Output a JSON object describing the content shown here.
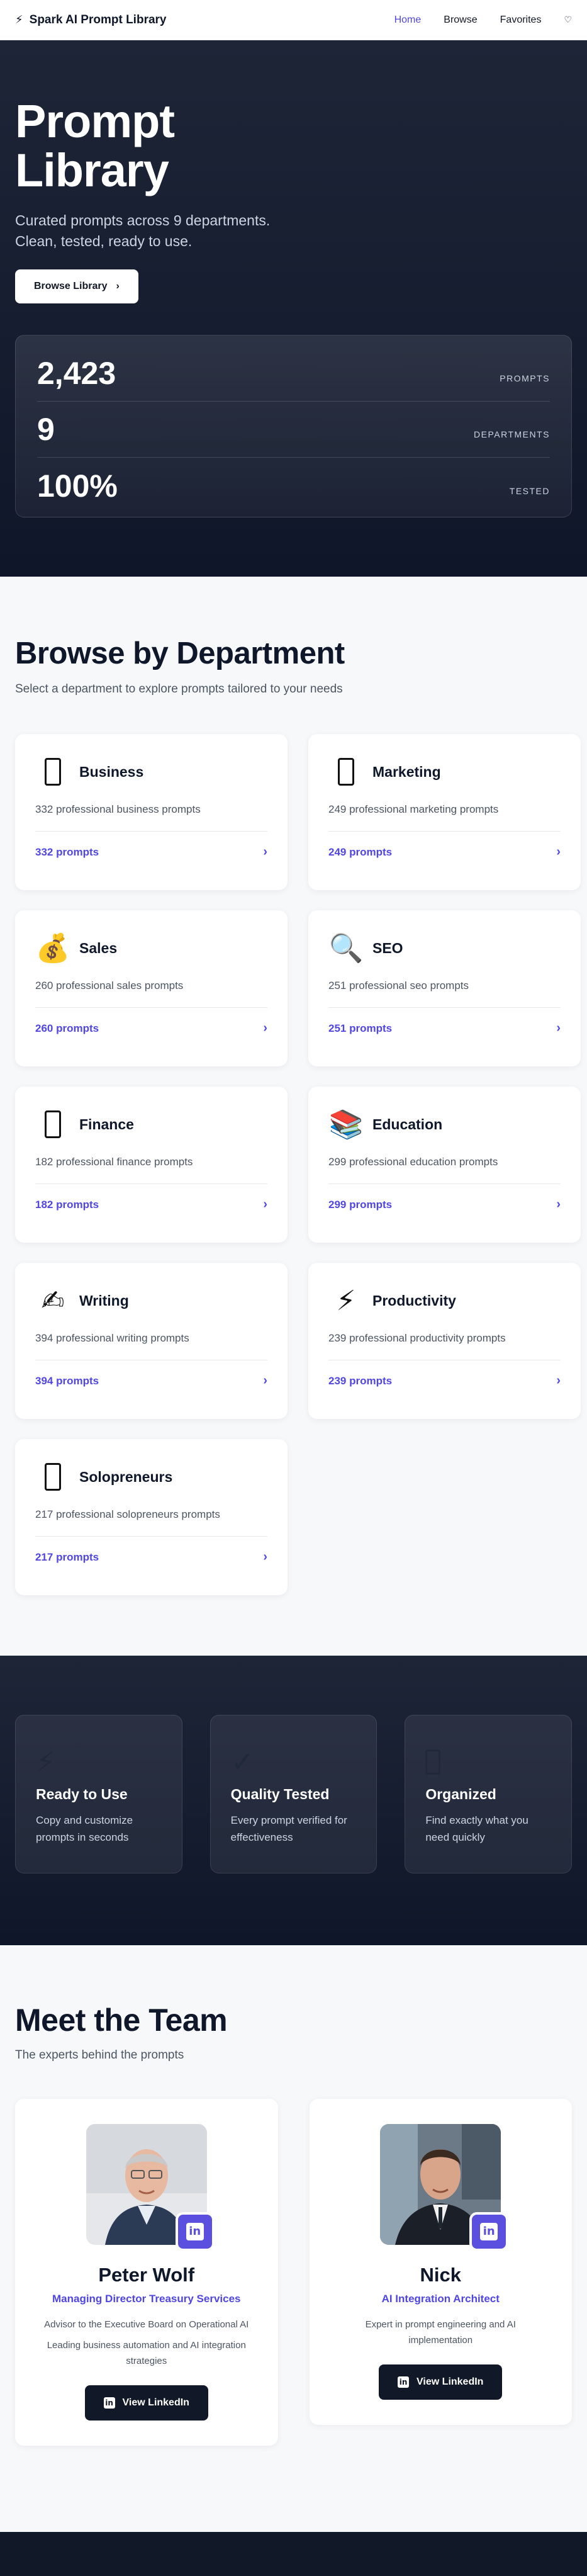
{
  "nav": {
    "brand": "Spark AI Prompt Library",
    "brand_icon": "⚡",
    "links": [
      "Home",
      "Browse",
      "Favorites"
    ],
    "active": "Home",
    "heart_icon": "♡"
  },
  "hero": {
    "title_line1": "Prompt",
    "title_line2": "Library",
    "subtitle_line1": "Curated prompts across 9 departments.",
    "subtitle_line2": "Clean, tested, ready to use.",
    "cta_label": "Browse Library",
    "cta_icon": "›",
    "stats": [
      {
        "value": "2,423",
        "label": "PROMPTS"
      },
      {
        "value": "9",
        "label": "DEPARTMENTS"
      },
      {
        "value": "100%",
        "label": "TESTED"
      }
    ]
  },
  "departments": {
    "title": "Browse by Department",
    "subtitle": "Select a department to explore prompts tailored to your needs",
    "items": [
      {
        "name": "Business",
        "icon": "frame",
        "desc": "332 professional business prompts",
        "count": "332 prompts"
      },
      {
        "name": "Marketing",
        "icon": "frame",
        "desc": "249 professional marketing prompts",
        "count": "249 prompts"
      },
      {
        "name": "Sales",
        "icon": "💰",
        "desc": "260 professional sales prompts",
        "count": "260 prompts"
      },
      {
        "name": "SEO",
        "icon": "🔍",
        "desc": "251 professional seo prompts",
        "count": "251 prompts"
      },
      {
        "name": "Finance",
        "icon": "frame",
        "desc": "182 professional finance prompts",
        "count": "182 prompts"
      },
      {
        "name": "Education",
        "icon": "📚",
        "desc": "299 professional education prompts",
        "count": "299 prompts"
      },
      {
        "name": "Writing",
        "icon": "✍",
        "desc": "394 professional writing prompts",
        "count": "394 prompts"
      },
      {
        "name": "Productivity",
        "icon": "⚡",
        "desc": "239 professional productivity prompts",
        "count": "239 prompts"
      },
      {
        "name": "Solopreneurs",
        "icon": "frame",
        "desc": "217 professional solopreneurs prompts",
        "count": "217 prompts"
      }
    ],
    "chevron": "›"
  },
  "features": [
    {
      "icon": "⚡",
      "title": "Ready to Use",
      "desc": "Copy and customize prompts in seconds"
    },
    {
      "icon": "✓",
      "title": "Quality Tested",
      "desc": "Every prompt verified for effectiveness"
    },
    {
      "icon": "frame",
      "title": "Organized",
      "desc": "Find exactly what you need quickly"
    }
  ],
  "team": {
    "title": "Meet the Team",
    "subtitle": "The experts behind the prompts",
    "members": [
      {
        "name": "Peter Wolf",
        "role": "Managing Director Treasury Services",
        "desc1": "Advisor to the Executive Board on Operational AI",
        "desc2": "Leading business automation and AI integration strategies",
        "button": "View LinkedIn"
      },
      {
        "name": "Nick",
        "role": "AI Integration Architect",
        "desc1": "Expert in prompt engineering and AI implementation",
        "desc2": "",
        "button": "View LinkedIn"
      }
    ]
  },
  "colors": {
    "accent": "#4f46e5",
    "dark": "#0f1629",
    "badge": "#5b4fe0"
  }
}
